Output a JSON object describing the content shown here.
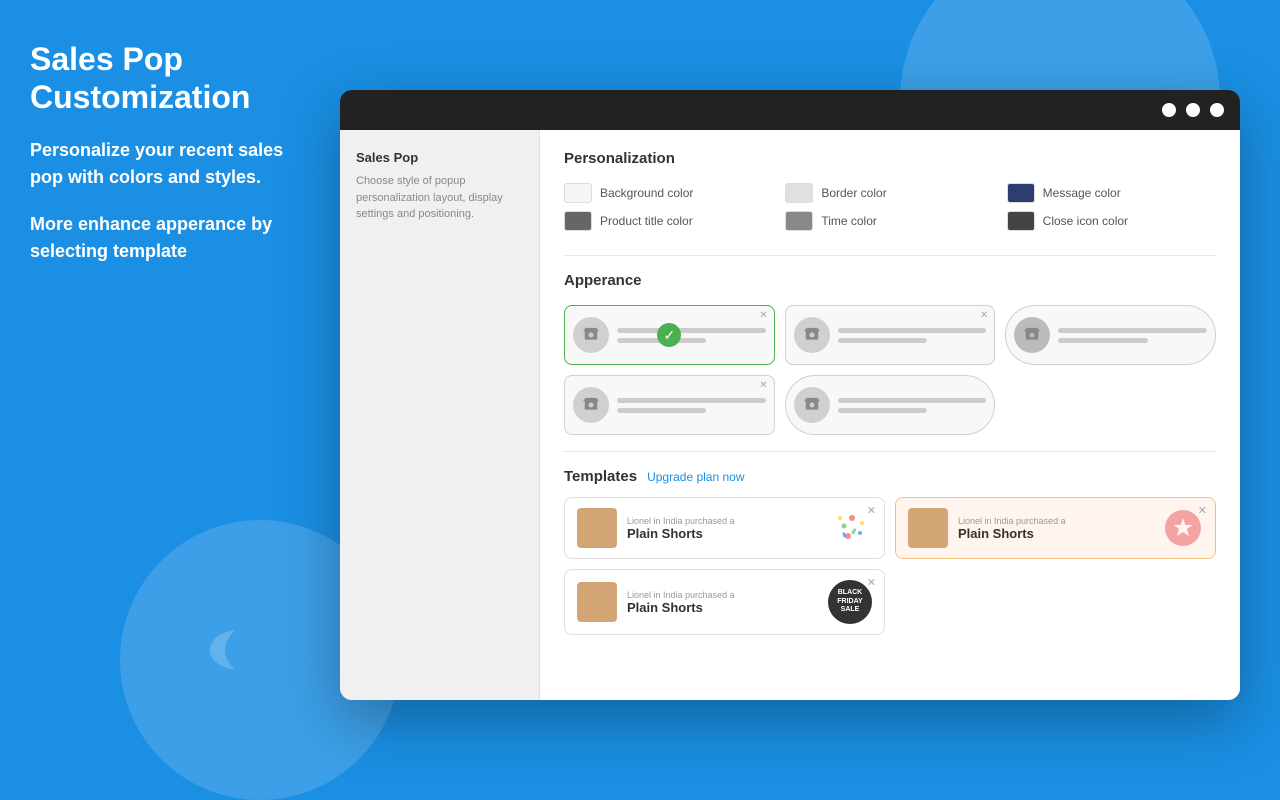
{
  "page": {
    "title": "Sales Pop Customization",
    "description_1": "Personalize your recent sales pop with colors and styles.",
    "description_2": "More enhance apperance by selecting template"
  },
  "sidebar": {
    "label": "Sales Pop",
    "sublabel": "Choose style of popup personalization layout, display settings and positioning."
  },
  "personalization": {
    "section_title": "Personalization",
    "colors": [
      {
        "label": "Background color",
        "color": "#f5f5f5",
        "col": 1
      },
      {
        "label": "Border color",
        "color": "#e0e0e0",
        "col": 2
      },
      {
        "label": "Message color",
        "color": "#2c3e6e",
        "col": 3
      },
      {
        "label": "Product title color",
        "color": "#555",
        "col": 1
      },
      {
        "label": "Time color",
        "color": "#777",
        "col": 2
      },
      {
        "label": "Close icon color",
        "color": "#444",
        "col": 3
      }
    ]
  },
  "appearance": {
    "section_title": "Apperance",
    "templates": [
      {
        "id": 1,
        "selected": true,
        "pill": false
      },
      {
        "id": 2,
        "selected": false,
        "pill": false
      },
      {
        "id": 3,
        "selected": false,
        "pill": true
      },
      {
        "id": 4,
        "selected": false,
        "pill": false
      },
      {
        "id": 5,
        "selected": false,
        "pill": false
      }
    ]
  },
  "templates": {
    "section_title": "Templates",
    "upgrade_label": "Upgrade plan now",
    "items": [
      {
        "id": 1,
        "purchased_by": "Lionel in India purchased a",
        "product_name": "Plain Shorts",
        "badge_type": "confetti",
        "bg": "white"
      },
      {
        "id": 2,
        "purchased_by": "Lionel in India purchased a",
        "product_name": "Plain Shorts",
        "badge_type": "star",
        "bg": "peach"
      },
      {
        "id": 3,
        "purchased_by": "Lionel in India purchased a",
        "product_name": "Plain Shorts",
        "badge_type": "blackfriday",
        "bg": "white"
      }
    ]
  }
}
